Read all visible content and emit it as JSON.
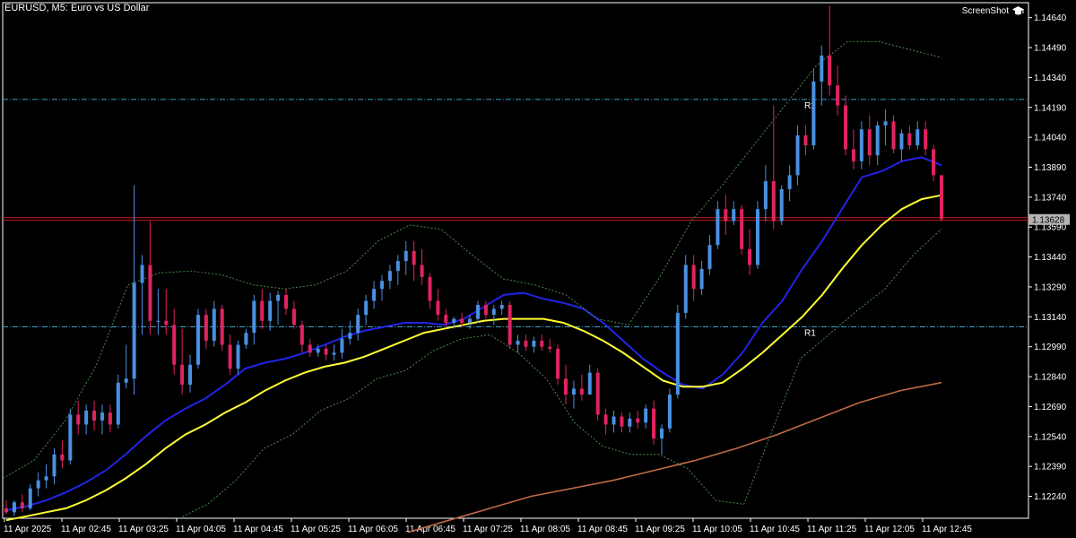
{
  "header": {
    "title": "EURUSD, M5:  Euro vs US Dollar",
    "watermark": "ScreenShot"
  },
  "chart_data": {
    "type": "candlestick",
    "symbol": "EURUSD",
    "timeframe": "M5",
    "ylim": [
      1.1213,
      1.14715
    ],
    "y_ticks": [
      "1.14640",
      "1.14490",
      "1.14340",
      "1.14190",
      "1.14040",
      "1.13890",
      "1.13740",
      "1.13590",
      "1.13440",
      "1.13290",
      "1.13140",
      "1.12990",
      "1.12840",
      "1.12690",
      "1.12540",
      "1.12390",
      "1.12240"
    ],
    "x_ticks": [
      "11 Apr 2025",
      "11 Apr 02:45",
      "11 Apr 03:25",
      "11 Apr 04:05",
      "11 Apr 04:45",
      "11 Apr 05:25",
      "11 Apr 06:05",
      "11 Apr 06:45",
      "11 Apr 07:25",
      "11 Apr 08:05",
      "11 Apr 08:45",
      "11 Apr 09:25",
      "11 Apr 10:05",
      "11 Apr 10:45",
      "11 Apr 11:25",
      "11 Apr 12:05",
      "11 Apr 12:45"
    ],
    "current_price": "1.13628",
    "levels": [
      {
        "name": "R2",
        "price": 1.1423,
        "color": "#3aa0c8"
      },
      {
        "name": "R1",
        "price": 1.1309,
        "color": "#3aa0c8"
      },
      {
        "name": "",
        "price": 1.13628,
        "color": "#c81e1e"
      }
    ],
    "colors": {
      "bull": "#4a90e2",
      "bear": "#e0245e",
      "ma_fast": "#2323e6",
      "ma_slow": "#ffff33",
      "ma_long": "#c06a45",
      "bands": "#4a8a4a"
    },
    "series": [
      {
        "name": "MA fast",
        "values": [
          1.1217,
          1.1219,
          1.1222,
          1.1226,
          1.1231,
          1.1237,
          1.1245,
          1.1254,
          1.1262,
          1.1268,
          1.1273,
          1.128,
          1.1288,
          1.1291,
          1.1293,
          1.1296,
          1.13,
          1.1304,
          1.1307,
          1.1309,
          1.1311,
          1.1311,
          1.131,
          1.1313,
          1.1319,
          1.1325,
          1.1326,
          1.1323,
          1.1321,
          1.1318,
          1.1311,
          1.1302,
          1.1293,
          1.1286,
          1.128,
          1.1278,
          1.1285,
          1.1296,
          1.1311,
          1.1322,
          1.1338,
          1.1352,
          1.1368,
          1.1384,
          1.1387,
          1.1392,
          1.1394,
          1.139
        ]
      },
      {
        "name": "MA slow",
        "values": [
          1.1212,
          1.1214,
          1.1216,
          1.1218,
          1.1222,
          1.1227,
          1.1233,
          1.124,
          1.1248,
          1.1255,
          1.126,
          1.1266,
          1.1271,
          1.1277,
          1.1282,
          1.1286,
          1.1289,
          1.1291,
          1.1294,
          1.1298,
          1.1302,
          1.1306,
          1.1308,
          1.131,
          1.1312,
          1.1313,
          1.1313,
          1.1313,
          1.1311,
          1.1307,
          1.1302,
          1.1296,
          1.1289,
          1.1282,
          1.1279,
          1.1279,
          1.1281,
          1.1288,
          1.1296,
          1.1305,
          1.1314,
          1.1325,
          1.1338,
          1.135,
          1.136,
          1.1368,
          1.1373,
          1.1375
        ]
      },
      {
        "name": "MA long",
        "values": [
          1.1206,
          1.1212,
          1.1218,
          1.1224,
          1.1228,
          1.1232,
          1.1237,
          1.1242,
          1.1248,
          1.1255,
          1.1263,
          1.1271,
          1.1277,
          1.1281
        ]
      },
      {
        "name": "Bands upper",
        "values": [
          1.1233,
          1.1242,
          1.1262,
          1.129,
          1.133,
          1.1336,
          1.1337,
          1.1335,
          1.133,
          1.1328,
          1.133,
          1.1337,
          1.1352,
          1.136,
          1.1358,
          1.1345,
          1.1333,
          1.133,
          1.1325,
          1.1313,
          1.131,
          1.1334,
          1.1362,
          1.138,
          1.14,
          1.142,
          1.144,
          1.1452,
          1.1452,
          1.1448,
          1.1444
        ]
      },
      {
        "name": "Bands lower",
        "values": [
          1.1213,
          1.122,
          1.1232,
          1.1248,
          1.1255,
          1.1267,
          1.1273,
          1.1283,
          1.1287,
          1.1297,
          1.1303,
          1.1305,
          1.1296,
          1.1283,
          1.1261,
          1.1249,
          1.1245,
          1.1245,
          1.1238,
          1.1222,
          1.122,
          1.1257,
          1.1293,
          1.1305,
          1.1317,
          1.1328,
          1.1345,
          1.1358
        ]
      }
    ],
    "candles": [
      [
        1.1218,
        1.1222,
        1.1215,
        1.1216
      ],
      [
        1.1216,
        1.1222,
        1.1214,
        1.1221
      ],
      [
        1.1221,
        1.1225,
        1.1216,
        1.1218
      ],
      [
        1.1218,
        1.123,
        1.1217,
        1.1228
      ],
      [
        1.1228,
        1.1236,
        1.1224,
        1.1232
      ],
      [
        1.1232,
        1.124,
        1.1228,
        1.1234
      ],
      [
        1.1234,
        1.1248,
        1.123,
        1.1245
      ],
      [
        1.1245,
        1.1252,
        1.1238,
        1.1242
      ],
      [
        1.1242,
        1.1268,
        1.124,
        1.1265
      ],
      [
        1.1265,
        1.1272,
        1.1255,
        1.126
      ],
      [
        1.126,
        1.127,
        1.1255,
        1.1267
      ],
      [
        1.1267,
        1.1272,
        1.1257,
        1.1262
      ],
      [
        1.1262,
        1.127,
        1.1255,
        1.1266
      ],
      [
        1.1266,
        1.127,
        1.1256,
        1.126
      ],
      [
        1.126,
        1.1285,
        1.1258,
        1.1281
      ],
      [
        1.1281,
        1.13,
        1.1278,
        1.1283
      ],
      [
        1.1283,
        1.138,
        1.1275,
        1.1331
      ],
      [
        1.1331,
        1.1345,
        1.1305,
        1.134
      ],
      [
        1.134,
        1.1362,
        1.1305,
        1.1312
      ],
      [
        1.1312,
        1.1328,
        1.1305,
        1.1312
      ],
      [
        1.1312,
        1.1328,
        1.1305,
        1.131
      ],
      [
        1.131,
        1.1318,
        1.1285,
        1.129
      ],
      [
        1.129,
        1.1308,
        1.1275,
        1.128
      ],
      [
        1.128,
        1.1295,
        1.1276,
        1.129
      ],
      [
        1.129,
        1.1318,
        1.1288,
        1.1315
      ],
      [
        1.1315,
        1.1318,
        1.1298,
        1.1302
      ],
      [
        1.1302,
        1.1322,
        1.1299,
        1.1318
      ],
      [
        1.1318,
        1.132,
        1.1297,
        1.13
      ],
      [
        1.13,
        1.1305,
        1.1285,
        1.1288
      ],
      [
        1.1288,
        1.1302,
        1.1285,
        1.13
      ],
      [
        1.13,
        1.1308,
        1.1298,
        1.1306
      ],
      [
        1.1306,
        1.1325,
        1.13,
        1.1322
      ],
      [
        1.1322,
        1.1328,
        1.1308,
        1.1312
      ],
      [
        1.1312,
        1.1326,
        1.1307,
        1.1322
      ],
      [
        1.1322,
        1.1327,
        1.131,
        1.1325
      ],
      [
        1.1325,
        1.1328,
        1.1315,
        1.1318
      ],
      [
        1.1318,
        1.1322,
        1.1308,
        1.131
      ],
      [
        1.131,
        1.1312,
        1.1296,
        1.13
      ],
      [
        1.13,
        1.1303,
        1.1294,
        1.1296
      ],
      [
        1.1296,
        1.13,
        1.1294,
        1.1298
      ],
      [
        1.1298,
        1.13,
        1.1292,
        1.1295
      ],
      [
        1.1295,
        1.13,
        1.1292,
        1.1296
      ],
      [
        1.1296,
        1.1308,
        1.1293,
        1.1303
      ],
      [
        1.1303,
        1.1312,
        1.13,
        1.1306
      ],
      [
        1.1306,
        1.1318,
        1.1302,
        1.1315
      ],
      [
        1.1315,
        1.1325,
        1.131,
        1.1322
      ],
      [
        1.1322,
        1.1332,
        1.1318,
        1.1328
      ],
      [
        1.1328,
        1.1335,
        1.1322,
        1.1332
      ],
      [
        1.1332,
        1.134,
        1.1328,
        1.1337
      ],
      [
        1.1337,
        1.1345,
        1.133,
        1.1342
      ],
      [
        1.1342,
        1.1352,
        1.1335,
        1.1347
      ],
      [
        1.1347,
        1.1352,
        1.1332,
        1.134
      ],
      [
        1.134,
        1.1348,
        1.133,
        1.1334
      ],
      [
        1.1334,
        1.1336,
        1.1318,
        1.1322
      ],
      [
        1.1322,
        1.1328,
        1.1312,
        1.1315
      ],
      [
        1.1315,
        1.1318,
        1.1309,
        1.1311
      ],
      [
        1.1311,
        1.1314,
        1.1308,
        1.1313
      ],
      [
        1.1313,
        1.1316,
        1.1309,
        1.1311
      ],
      [
        1.1311,
        1.1315,
        1.1308,
        1.1313
      ],
      [
        1.1313,
        1.1322,
        1.1311,
        1.132
      ],
      [
        1.132,
        1.1322,
        1.1313,
        1.1315
      ],
      [
        1.1315,
        1.132,
        1.131,
        1.1318
      ],
      [
        1.1318,
        1.1322,
        1.1315,
        1.132
      ],
      [
        1.132,
        1.1322,
        1.1298,
        1.13
      ],
      [
        1.13,
        1.1305,
        1.1296,
        1.1302
      ],
      [
        1.1302,
        1.1305,
        1.1297,
        1.1299
      ],
      [
        1.1299,
        1.1304,
        1.1296,
        1.1302
      ],
      [
        1.1302,
        1.1305,
        1.1297,
        1.1299
      ],
      [
        1.1299,
        1.1303,
        1.1296,
        1.1298
      ],
      [
        1.1298,
        1.13,
        1.128,
        1.1283
      ],
      [
        1.1283,
        1.129,
        1.127,
        1.1275
      ],
      [
        1.1275,
        1.1282,
        1.1268,
        1.1278
      ],
      [
        1.1278,
        1.1285,
        1.1272,
        1.1275
      ],
      [
        1.1275,
        1.129,
        1.1275,
        1.1286
      ],
      [
        1.1286,
        1.1288,
        1.1262,
        1.1265
      ],
      [
        1.1265,
        1.1268,
        1.1255,
        1.126
      ],
      [
        1.126,
        1.1267,
        1.1256,
        1.1264
      ],
      [
        1.1264,
        1.1266,
        1.1256,
        1.1259
      ],
      [
        1.1259,
        1.1266,
        1.1256,
        1.1263
      ],
      [
        1.1263,
        1.1267,
        1.1258,
        1.1261
      ],
      [
        1.1261,
        1.127,
        1.1258,
        1.1268
      ],
      [
        1.1268,
        1.1272,
        1.125,
        1.1253
      ],
      [
        1.1253,
        1.126,
        1.1245,
        1.1258
      ],
      [
        1.1258,
        1.1278,
        1.1256,
        1.1275
      ],
      [
        1.1275,
        1.132,
        1.1273,
        1.1316
      ],
      [
        1.1316,
        1.1345,
        1.1313,
        1.134
      ],
      [
        1.134,
        1.1345,
        1.1322,
        1.1328
      ],
      [
        1.1328,
        1.1342,
        1.1325,
        1.1338
      ],
      [
        1.1338,
        1.1355,
        1.1335,
        1.135
      ],
      [
        1.135,
        1.1372,
        1.1348,
        1.1368
      ],
      [
        1.1368,
        1.1375,
        1.1355,
        1.1362
      ],
      [
        1.1362,
        1.1372,
        1.136,
        1.1368
      ],
      [
        1.1368,
        1.137,
        1.1345,
        1.1348
      ],
      [
        1.1348,
        1.1358,
        1.1335,
        1.134
      ],
      [
        1.134,
        1.1372,
        1.1338,
        1.1368
      ],
      [
        1.1368,
        1.139,
        1.1362,
        1.1382
      ],
      [
        1.1382,
        1.142,
        1.1358,
        1.1362
      ],
      [
        1.1362,
        1.138,
        1.136,
        1.1378
      ],
      [
        1.1378,
        1.139,
        1.1372,
        1.1385
      ],
      [
        1.1385,
        1.141,
        1.138,
        1.1405
      ],
      [
        1.1405,
        1.141,
        1.1395,
        1.14
      ],
      [
        1.14,
        1.1438,
        1.1398,
        1.1432
      ],
      [
        1.1432,
        1.145,
        1.142,
        1.1445
      ],
      [
        1.1445,
        1.147,
        1.1425,
        1.143
      ],
      [
        1.143,
        1.144,
        1.1415,
        1.142
      ],
      [
        1.142,
        1.1425,
        1.1395,
        1.1398
      ],
      [
        1.1398,
        1.1408,
        1.1388,
        1.1392
      ],
      [
        1.1392,
        1.1412,
        1.1388,
        1.1408
      ],
      [
        1.1408,
        1.1415,
        1.139,
        1.1395
      ],
      [
        1.1395,
        1.1412,
        1.139,
        1.141
      ],
      [
        1.141,
        1.1418,
        1.14,
        1.1412
      ],
      [
        1.1412,
        1.1415,
        1.1396,
        1.1398
      ],
      [
        1.1398,
        1.1408,
        1.1392,
        1.1406
      ],
      [
        1.1406,
        1.141,
        1.1398,
        1.14
      ],
      [
        1.14,
        1.1412,
        1.1398,
        1.1408
      ],
      [
        1.1408,
        1.1412,
        1.1395,
        1.1398
      ],
      [
        1.1398,
        1.14,
        1.1382,
        1.1385
      ],
      [
        1.1385,
        1.1385,
        1.1362,
        1.1363
      ]
    ]
  }
}
